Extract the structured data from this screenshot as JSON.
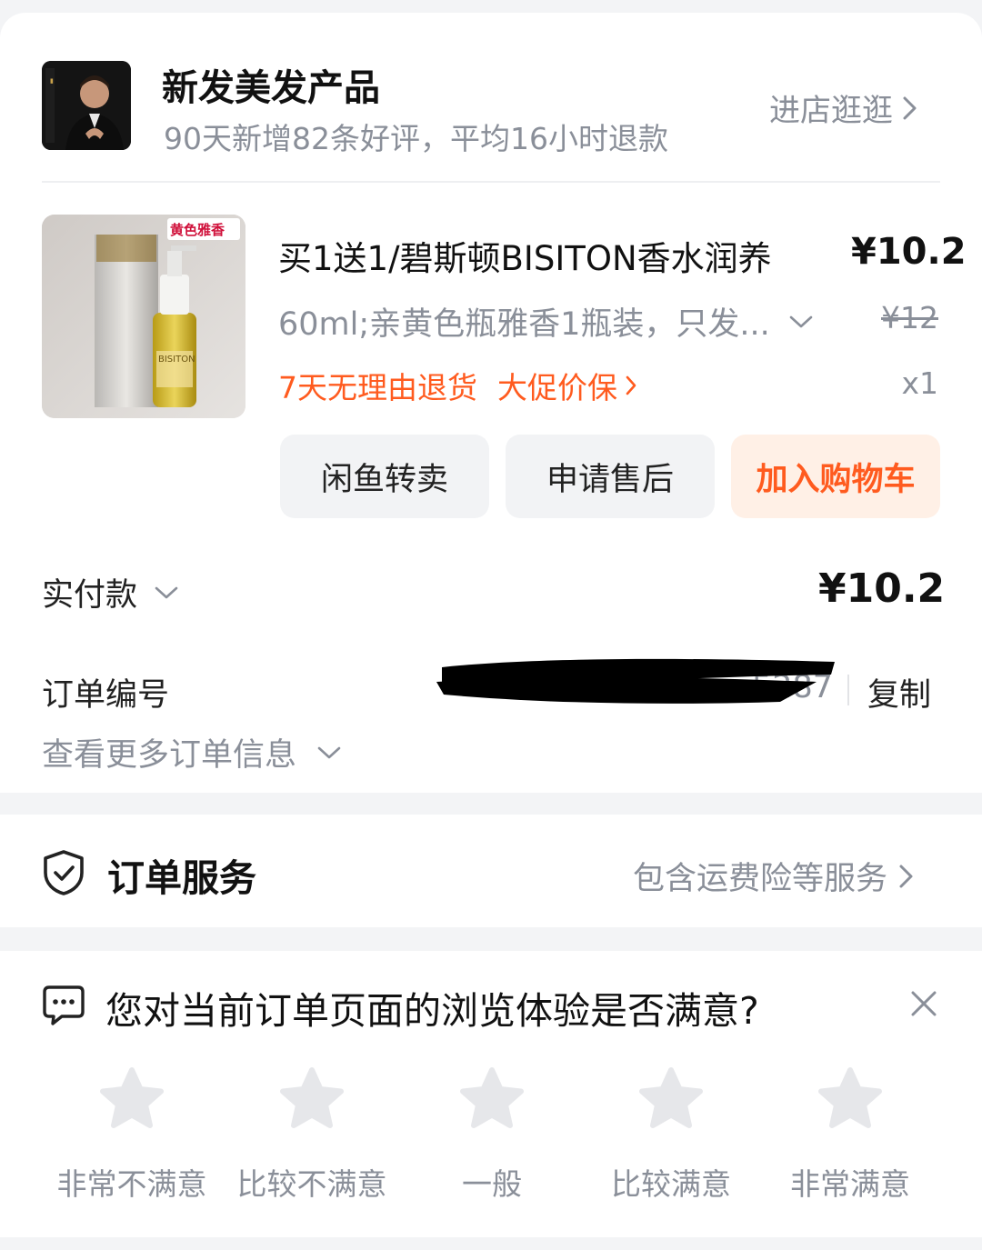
{
  "shop": {
    "name": "新发美发产品",
    "description": "90天新增82条好评，平均16小时退款",
    "link_label": "进店逛逛",
    "logo_icon": "shop-avatar-portrait"
  },
  "product": {
    "title": "买1送1/碧斯顿BISITON香水润养",
    "price": "¥10.2",
    "sku": "60ml;亲黄色瓶雅香1瓶装，只发...",
    "original_price": "¥12",
    "tag_return": "7天无理由退货",
    "tag_price_protect": "大促价保",
    "quantity": "x1",
    "image_badge": "黄色雅香",
    "image_brand": "BISITON"
  },
  "actions": {
    "resell": "闲鱼转卖",
    "after_sale": "申请售后",
    "add_to_cart": "加入购物车"
  },
  "payment": {
    "label": "实付款",
    "amount": "¥10.2"
  },
  "order": {
    "number_label": "订单编号",
    "number_visible_suffix": "5287",
    "copy_label": "复制",
    "more_info_label": "查看更多订单信息"
  },
  "service": {
    "title": "订单服务",
    "link_label": "包含运费险等服务"
  },
  "survey": {
    "question": "您对当前订单页面的浏览体验是否满意?",
    "options": [
      "非常不满意",
      "比较不满意",
      "一般",
      "比较满意",
      "非常满意"
    ]
  },
  "colors": {
    "accent": "#ff5b1f",
    "accent_bg": "#fff0e6",
    "muted_text": "#8a8f99",
    "star": "#e6e7ea"
  }
}
